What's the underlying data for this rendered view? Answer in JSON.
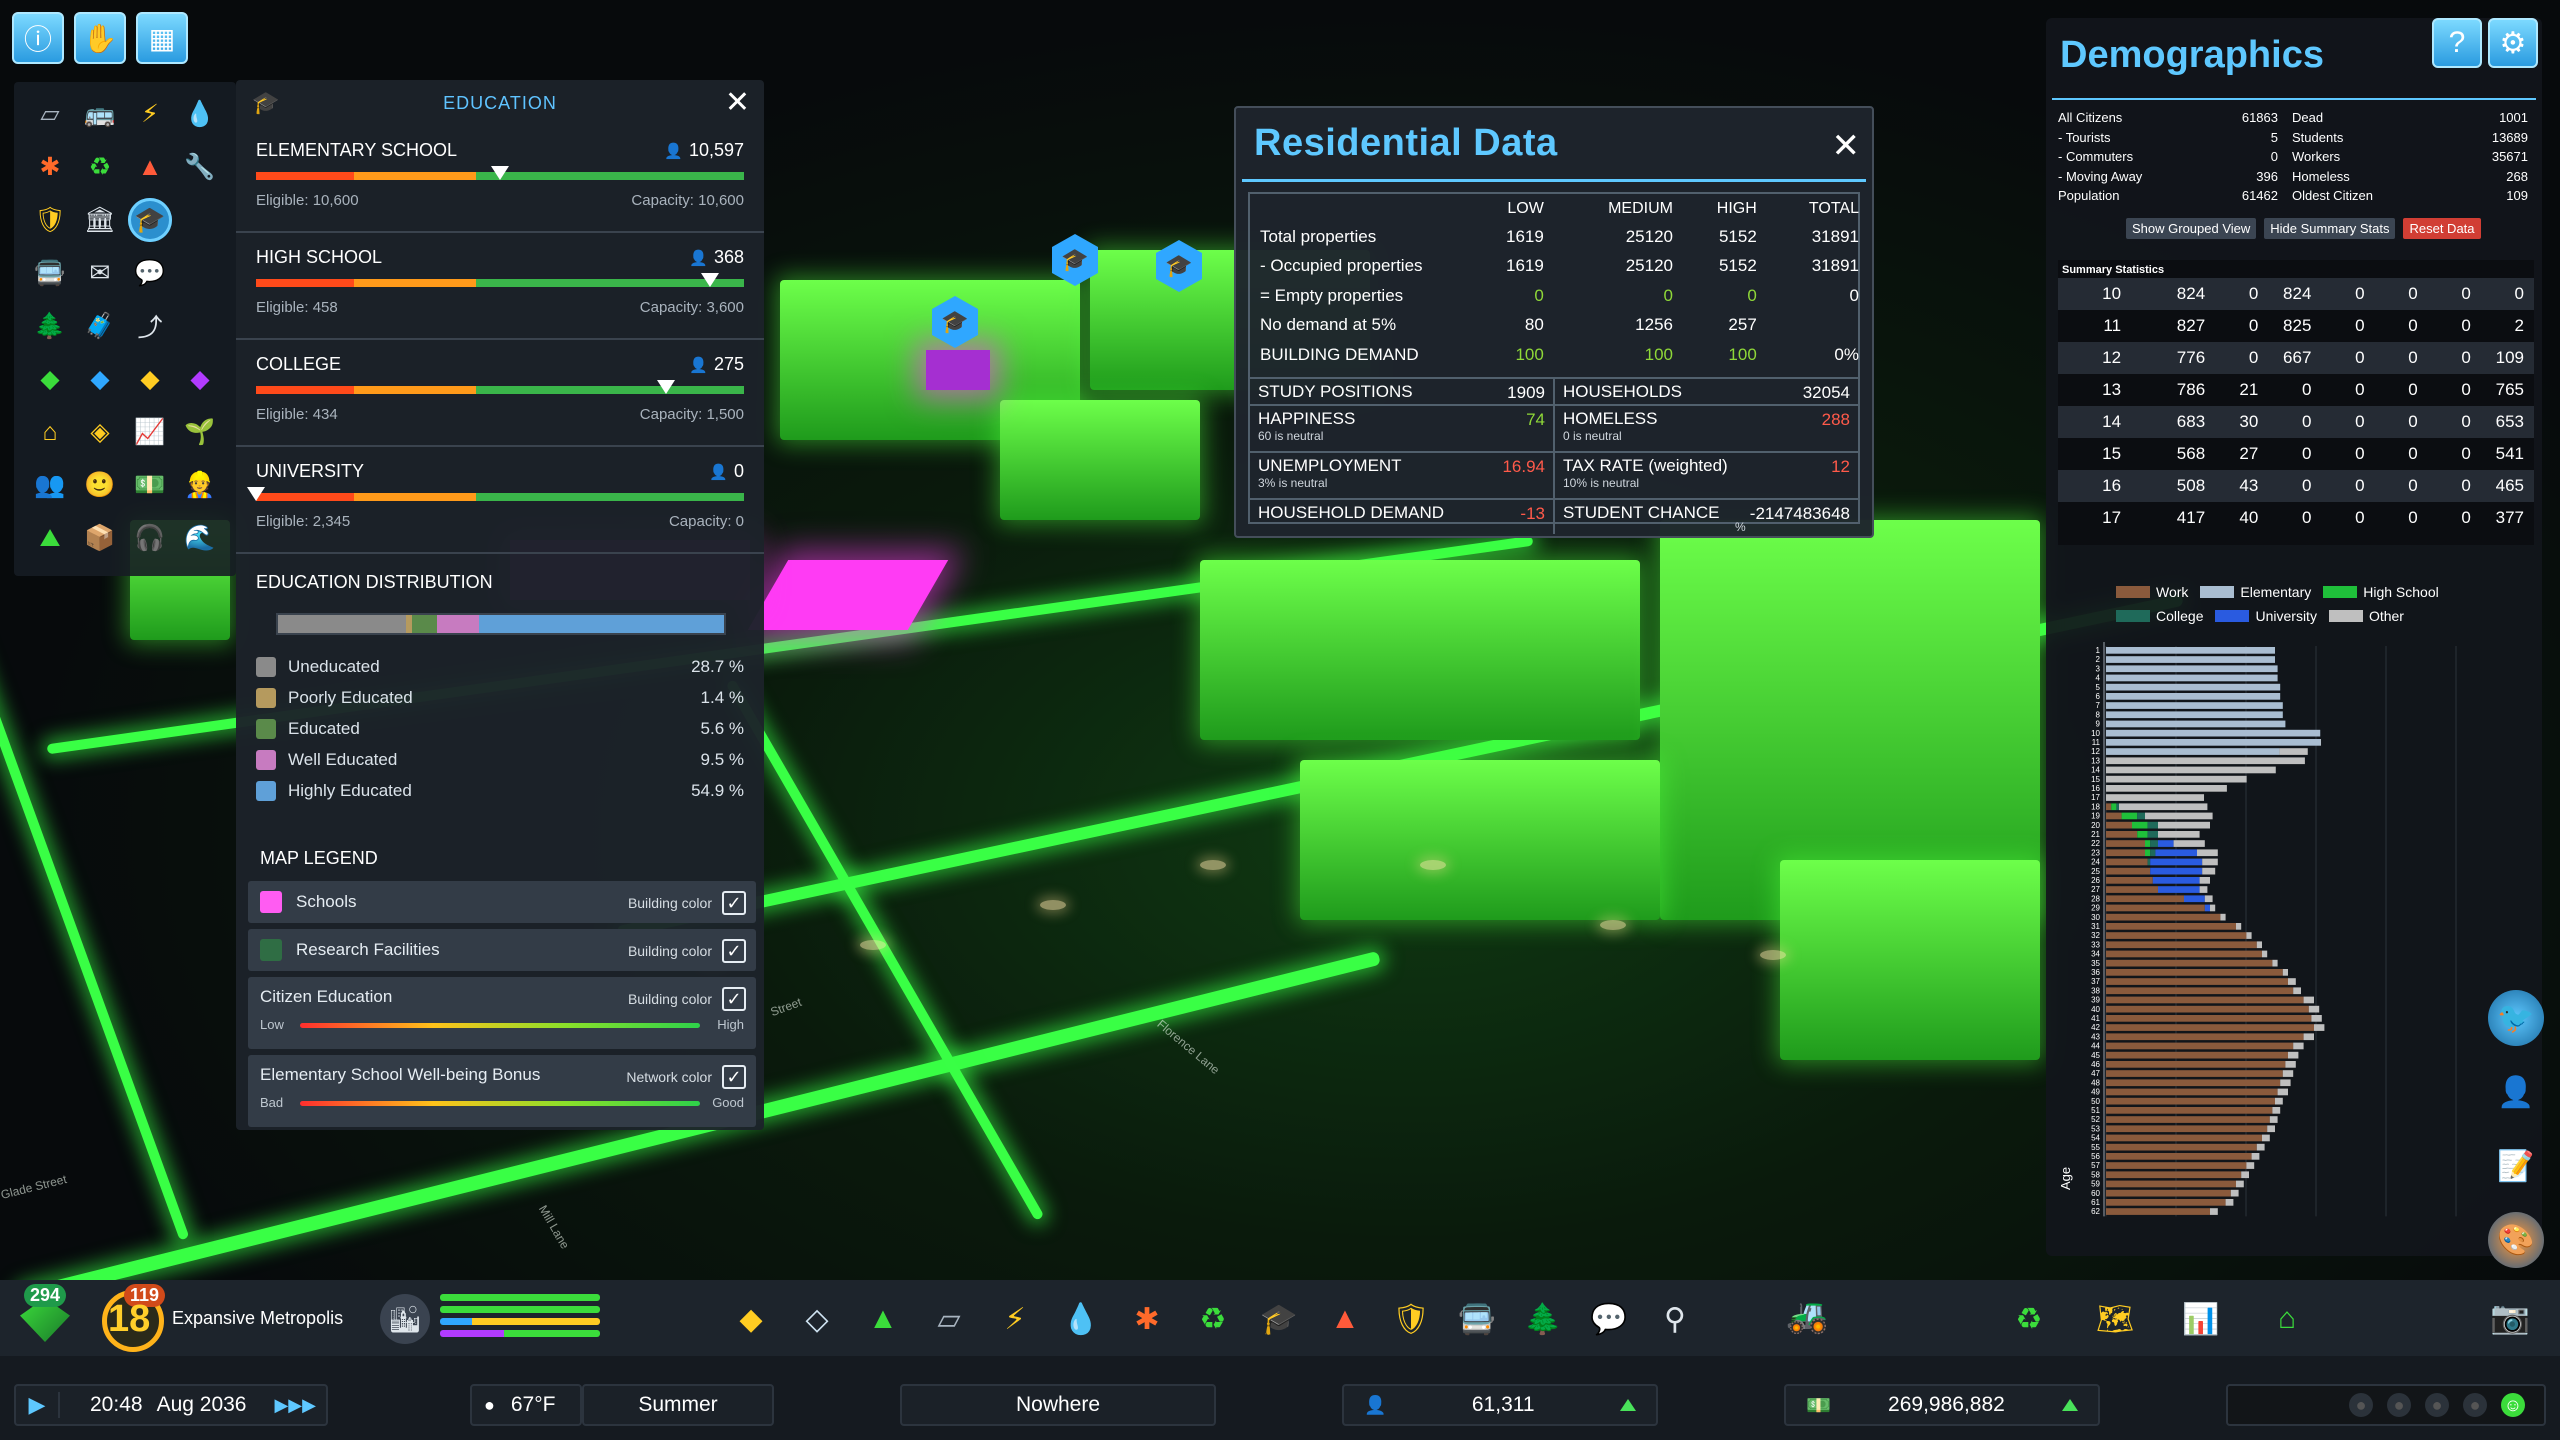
{
  "education": {
    "title": "EDUCATION",
    "levels": [
      {
        "name": "ELEMENTARY SCHOOL",
        "count": "10,597",
        "eligible": "Eligible: 10,600",
        "capacity": "Capacity: 10,600",
        "marker": 0.5
      },
      {
        "name": "HIGH SCHOOL",
        "count": "368",
        "eligible": "Eligible: 458",
        "capacity": "Capacity: 3,600",
        "marker": 0.93
      },
      {
        "name": "COLLEGE",
        "count": "275",
        "eligible": "Eligible: 434",
        "capacity": "Capacity: 1,500",
        "marker": 0.84
      },
      {
        "name": "UNIVERSITY",
        "count": "0",
        "eligible": "Eligible: 2,345",
        "capacity": "Capacity: 0",
        "marker": 0.0
      }
    ],
    "distribution_title": "EDUCATION DISTRIBUTION",
    "distribution": [
      {
        "label": "Uneducated",
        "value": "28.7 %",
        "pct": 28.7,
        "color": "#8a8a8a"
      },
      {
        "label": "Poorly Educated",
        "value": "1.4 %",
        "pct": 1.4,
        "color": "#b59a5e"
      },
      {
        "label": "Educated",
        "value": "5.6 %",
        "pct": 5.6,
        "color": "#5a8a4a"
      },
      {
        "label": "Well Educated",
        "value": "9.5 %",
        "pct": 9.5,
        "color": "#c77bc0"
      },
      {
        "label": "Highly Educated",
        "value": "54.9 %",
        "pct": 54.9,
        "color": "#5fa0d8"
      }
    ],
    "map_legend_title": "MAP LEGEND",
    "map_legend": {
      "schools": {
        "label": "Schools",
        "mode": "Building color",
        "color": "#ff5cf2"
      },
      "research": {
        "label": "Research Facilities",
        "mode": "Building color",
        "color": "#2f6d44"
      },
      "citizen_education": {
        "label": "Citizen Education",
        "mode": "Building color",
        "low": "Low",
        "high": "High"
      },
      "wellbeing": {
        "label": "Elementary School Well-being Bonus",
        "mode": "Network color",
        "low": "Bad",
        "high": "Good"
      }
    }
  },
  "residential": {
    "title": "Residential Data",
    "columns": [
      "LOW",
      "MEDIUM",
      "HIGH",
      "TOTAL"
    ],
    "rows": [
      {
        "label": "Total properties",
        "values": [
          "1619",
          "25120",
          "5152",
          "31891"
        ],
        "green": false
      },
      {
        "label": "- Occupied properties",
        "values": [
          "1619",
          "25120",
          "5152",
          "31891"
        ],
        "green": false
      },
      {
        "label": "= Empty properties",
        "values": [
          "0",
          "0",
          "0",
          "0"
        ],
        "green": true
      },
      {
        "label": "No demand at 5%",
        "values": [
          "80",
          "1256",
          "257",
          ""
        ],
        "green": false
      },
      {
        "label": "BUILDING DEMAND",
        "values": [
          "100",
          "100",
          "100",
          "0%"
        ],
        "green": true
      }
    ],
    "left_stats": [
      {
        "label": "STUDY POSITIONS",
        "value": "1909",
        "note": "",
        "color": "white"
      },
      {
        "label": "HAPPINESS",
        "value": "74",
        "note": "60 is neutral",
        "color": "green"
      },
      {
        "label": "UNEMPLOYMENT",
        "value": "16.94",
        "note": "3% is neutral",
        "color": "red"
      },
      {
        "label": "HOUSEHOLD DEMAND",
        "value": "-13",
        "note": "",
        "color": "red"
      }
    ],
    "right_stats": [
      {
        "label": "HOUSEHOLDS",
        "value": "32054",
        "note": "",
        "color": "white"
      },
      {
        "label": "HOMELESS",
        "value": "288",
        "note": "0 is neutral",
        "color": "red"
      },
      {
        "label": "TAX RATE (weighted)",
        "value": "12",
        "note": "10% is neutral",
        "color": "red"
      },
      {
        "label": "STUDENT CHANCE",
        "value": "-2147483648",
        "note": "%",
        "color": "white"
      }
    ]
  },
  "demographics": {
    "title": "Demographics",
    "stats": [
      [
        "All Citizens",
        "61863",
        "Dead",
        "1001"
      ],
      [
        "- Tourists",
        "5",
        "Students",
        "13689"
      ],
      [
        "- Commuters",
        "0",
        "Workers",
        "35671"
      ],
      [
        "- Moving Away",
        "396",
        "Homeless",
        "268"
      ],
      [
        "Population",
        "61462",
        "Oldest Citizen",
        "109"
      ]
    ],
    "buttons": [
      "Show Grouped View",
      "Hide Summary Stats",
      "Reset Data"
    ],
    "summary_title": "Summary Statistics",
    "summary_rows": [
      [
        "10",
        "824",
        "0",
        "824",
        "0",
        "0",
        "0",
        "0"
      ],
      [
        "11",
        "827",
        "0",
        "825",
        "0",
        "0",
        "0",
        "2"
      ],
      [
        "12",
        "776",
        "0",
        "667",
        "0",
        "0",
        "0",
        "109"
      ],
      [
        "13",
        "786",
        "21",
        "0",
        "0",
        "0",
        "0",
        "765"
      ],
      [
        "14",
        "683",
        "30",
        "0",
        "0",
        "0",
        "0",
        "653"
      ],
      [
        "15",
        "568",
        "27",
        "0",
        "0",
        "0",
        "0",
        "541"
      ],
      [
        "16",
        "508",
        "43",
        "0",
        "0",
        "0",
        "0",
        "465"
      ],
      [
        "17",
        "417",
        "40",
        "0",
        "0",
        "0",
        "0",
        "377"
      ]
    ],
    "legend": [
      {
        "label": "Work",
        "color": "#8a5a3c"
      },
      {
        "label": "Elementary",
        "color": "#a9bdd1"
      },
      {
        "label": "High School",
        "color": "#1fbf3a"
      },
      {
        "label": "College",
        "color": "#1f6a5a"
      },
      {
        "label": "University",
        "color": "#2a5be0"
      },
      {
        "label": "Other",
        "color": "#bfbfbf"
      }
    ],
    "age_axis_label": "Age"
  },
  "chart_data": {
    "type": "bar",
    "title": "",
    "ylabel": "Age",
    "categories": [
      "1",
      "2",
      "3",
      "4",
      "5",
      "6",
      "7",
      "8",
      "9",
      "10",
      "11",
      "12",
      "13",
      "14",
      "15",
      "16",
      "17",
      "18",
      "19",
      "20",
      "21",
      "22",
      "23",
      "24",
      "25",
      "26",
      "27",
      "28",
      "29",
      "30",
      "31",
      "32",
      "33",
      "34",
      "35",
      "36",
      "37",
      "38",
      "39",
      "40",
      "41",
      "42",
      "43",
      "44",
      "45",
      "46",
      "47",
      "48",
      "49",
      "50",
      "51",
      "52",
      "53",
      "54",
      "55",
      "56",
      "57",
      "58",
      "59",
      "60",
      "61",
      "62"
    ],
    "series": [
      {
        "name": "Work",
        "values": [
          0,
          0,
          0,
          0,
          0,
          0,
          0,
          0,
          0,
          0,
          0,
          0,
          0,
          0,
          0,
          0,
          0,
          20,
          60,
          100,
          120,
          150,
          150,
          160,
          170,
          180,
          200,
          300,
          380,
          440,
          500,
          540,
          580,
          600,
          640,
          680,
          700,
          720,
          760,
          780,
          790,
          800,
          760,
          720,
          700,
          690,
          680,
          670,
          660,
          650,
          640,
          630,
          620,
          600,
          580,
          560,
          540,
          520,
          500,
          480,
          460,
          400
        ]
      },
      {
        "name": "Elementary",
        "values": [
          650,
          650,
          660,
          660,
          670,
          670,
          680,
          680,
          690,
          824,
          825,
          667,
          0,
          0,
          0,
          0,
          0,
          0,
          0,
          0,
          0,
          0,
          0,
          0,
          0,
          0,
          0,
          0,
          0,
          0,
          0,
          0,
          0,
          0,
          0,
          0,
          0,
          0,
          0,
          0,
          0,
          0,
          0,
          0,
          0,
          0,
          0,
          0,
          0,
          0,
          0,
          0,
          0,
          0,
          0,
          0,
          0,
          0,
          0,
          0,
          0,
          0
        ]
      },
      {
        "name": "High School",
        "values": [
          0,
          0,
          0,
          0,
          0,
          0,
          0,
          0,
          0,
          0,
          0,
          0,
          0,
          0,
          0,
          0,
          0,
          20,
          60,
          60,
          40,
          20,
          20,
          0,
          0,
          0,
          0,
          0,
          0,
          0,
          0,
          0,
          0,
          0,
          0,
          0,
          0,
          0,
          0,
          0,
          0,
          0,
          0,
          0,
          0,
          0,
          0,
          0,
          0,
          0,
          0,
          0,
          0,
          0,
          0,
          0,
          0,
          0,
          0,
          0,
          0,
          0
        ]
      },
      {
        "name": "College",
        "values": [
          0,
          0,
          0,
          0,
          0,
          0,
          0,
          0,
          0,
          0,
          0,
          0,
          0,
          0,
          0,
          0,
          0,
          10,
          30,
          40,
          40,
          30,
          20,
          10,
          0,
          0,
          0,
          0,
          0,
          0,
          0,
          0,
          0,
          0,
          0,
          0,
          0,
          0,
          0,
          0,
          0,
          0,
          0,
          0,
          0,
          0,
          0,
          0,
          0,
          0,
          0,
          0,
          0,
          0,
          0,
          0,
          0,
          0,
          0,
          0,
          0,
          0
        ]
      },
      {
        "name": "University",
        "values": [
          0,
          0,
          0,
          0,
          0,
          0,
          0,
          0,
          0,
          0,
          0,
          0,
          0,
          0,
          0,
          0,
          0,
          0,
          0,
          0,
          0,
          60,
          160,
          200,
          200,
          180,
          160,
          80,
          20,
          0,
          0,
          0,
          0,
          0,
          0,
          0,
          0,
          0,
          0,
          0,
          0,
          0,
          0,
          0,
          0,
          0,
          0,
          0,
          0,
          0,
          0,
          0,
          0,
          0,
          0,
          0,
          0,
          0,
          0,
          0,
          0,
          0
        ]
      },
      {
        "name": "Other",
        "values": [
          0,
          0,
          0,
          0,
          0,
          0,
          0,
          0,
          0,
          0,
          2,
          109,
          765,
          653,
          541,
          465,
          377,
          340,
          260,
          200,
          160,
          120,
          80,
          60,
          50,
          40,
          30,
          30,
          20,
          20,
          20,
          20,
          20,
          20,
          20,
          20,
          30,
          30,
          40,
          40,
          40,
          40,
          40,
          40,
          40,
          40,
          40,
          40,
          40,
          30,
          30,
          30,
          30,
          30,
          30,
          30,
          30,
          30,
          30,
          30,
          30,
          30
        ]
      }
    ]
  },
  "toolbar": {
    "milestone_badge": "294",
    "level_badge": "119",
    "level": "18",
    "city_name": "Expansive Metropolis"
  },
  "status": {
    "time": "20:48",
    "date": "Aug 2036",
    "speed": "▶▶▶",
    "temperature": "67°F",
    "season": "Summer",
    "location": "Nowhere",
    "population": "61,311",
    "money": "269,986,882"
  },
  "street_names": [
    "Glade Street",
    "Mill Lane",
    "Florence Lane",
    "Street"
  ],
  "colors": {
    "accent": "#5ec8ff",
    "glow_green": "#39ff45",
    "schools_pink": "#ff3bf4"
  }
}
